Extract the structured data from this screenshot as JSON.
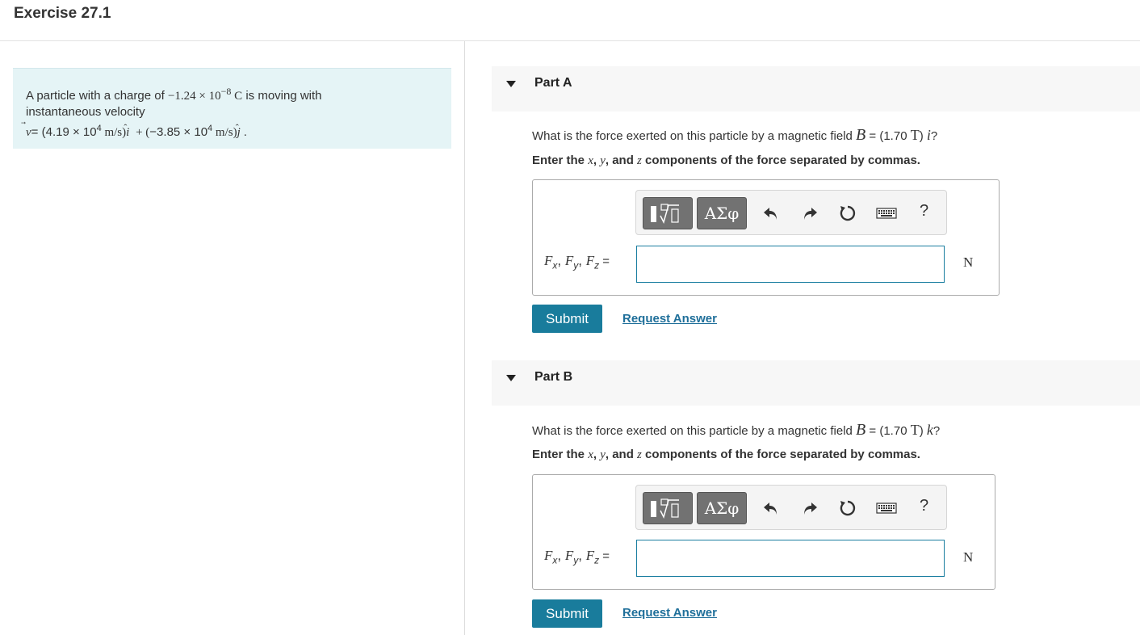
{
  "header": {
    "title": "Exercise 27.1"
  },
  "problem": {
    "line1_prefix": "A particle with a charge of ",
    "charge": "−1.24 × 10",
    "charge_exp": "−8",
    "charge_unit": "C",
    "line1_suffix": "is moving with",
    "line2": "instantaneous velocity",
    "v_symbol": "v",
    "v_eq": "= (",
    "v_x": "4.19 × 10",
    "v_x_exp": "4",
    "v_x_unit": " m/s",
    "i_hat": "i",
    "plus": " + (",
    "v_y": "−3.85 × 10",
    "v_y_exp": "4",
    "v_y_unit": " m/s",
    "j_hat": "j",
    "end": "."
  },
  "partA": {
    "title": "Part A",
    "question_prefix": "What is the force exerted on this particle by a magnetic field ",
    "B_symbol": "B",
    "B_eq": " = (1.70 ",
    "B_unit": "T",
    "B_dir": "i",
    "q_mark": "?",
    "instruction_1": "Enter the ",
    "x": "x",
    "comma": ", ",
    "y": "y",
    "and": ", and ",
    "z": "z",
    "instruction_2": " components of the force separated by commas.",
    "eq_label_F": "F",
    "sub_x": "x",
    "sub_y": "y",
    "sub_z": "z",
    "eq_sign": " =",
    "answer_value": "",
    "unit": "N",
    "submit": "Submit",
    "request_answer": "Request Answer"
  },
  "partB": {
    "title": "Part B",
    "question_prefix": "What is the force exerted on this particle by a magnetic field ",
    "B_symbol": "B",
    "B_eq": " = (1.70 ",
    "B_unit": "T",
    "B_dir": "k",
    "q_mark": "?",
    "instruction_1": "Enter the ",
    "x": "x",
    "comma": ", ",
    "y": "y",
    "and": ", and ",
    "z": "z",
    "instruction_2": " components of the force separated by commas.",
    "eq_label_F": "F",
    "sub_x": "x",
    "sub_y": "y",
    "sub_z": "z",
    "eq_sign": " =",
    "answer_value": "",
    "unit": "N",
    "submit": "Submit",
    "request_answer": "Request Answer"
  },
  "toolbar": {
    "greek_label": "ΑΣφ",
    "help_label": "?",
    "icons": [
      "templates-icon",
      "greek-symbols-icon",
      "undo-icon",
      "redo-icon",
      "reset-icon",
      "keyboard-icon",
      "help-icon"
    ]
  },
  "colors": {
    "accent": "#197c9c",
    "link": "#1f6f9a",
    "problem_bg": "#e5f4f6",
    "input_border": "#1a7ea0"
  }
}
